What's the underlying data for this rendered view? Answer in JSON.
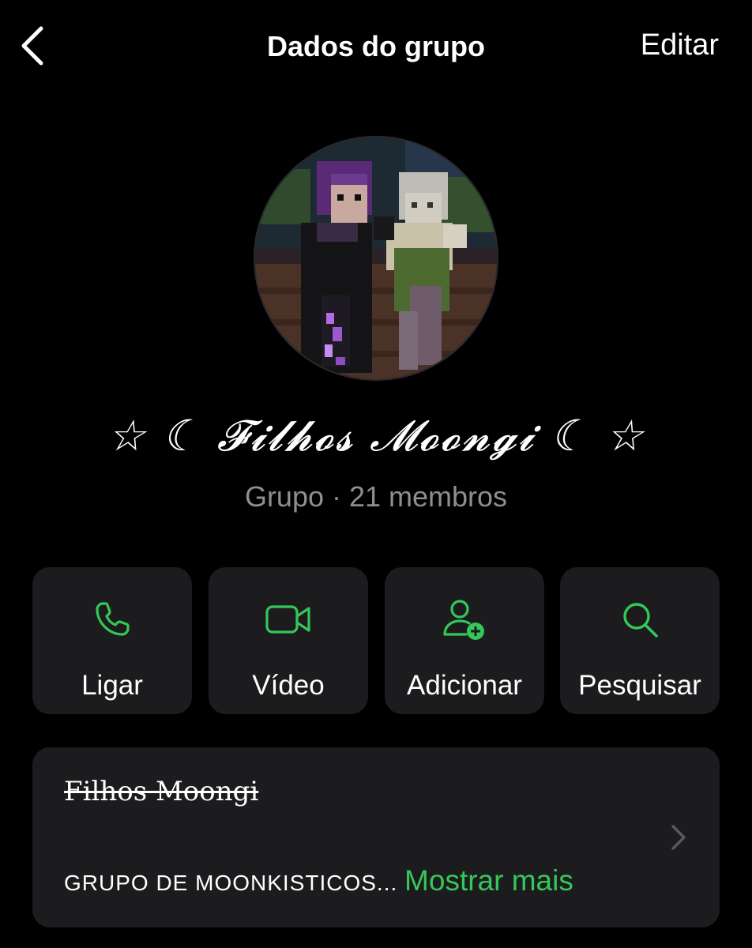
{
  "header": {
    "title": "Dados do grupo",
    "edit_label": "Editar"
  },
  "group": {
    "name": "☆ ☾ 𝓕𝓲𝓵𝓱𝓸𝓼 𝓜𝓸𝓸𝓷𝓰𝓲 ☾ ☆",
    "meta": "Grupo · 21 membros"
  },
  "actions": [
    {
      "label": "Ligar",
      "icon": "phone-icon"
    },
    {
      "label": "Vídeo",
      "icon": "video-icon"
    },
    {
      "label": "Adicionar",
      "icon": "add-person-icon"
    },
    {
      "label": "Pesquisar",
      "icon": "search-icon"
    }
  ],
  "description": {
    "title": "Filhos Moongi",
    "text": "GRUPO DE MOONKISTICOS...",
    "show_more": "Mostrar mais"
  },
  "colors": {
    "accent": "#34c759",
    "card": "#1c1c1e",
    "secondary_text": "#8e8e93",
    "background": "#000000"
  }
}
